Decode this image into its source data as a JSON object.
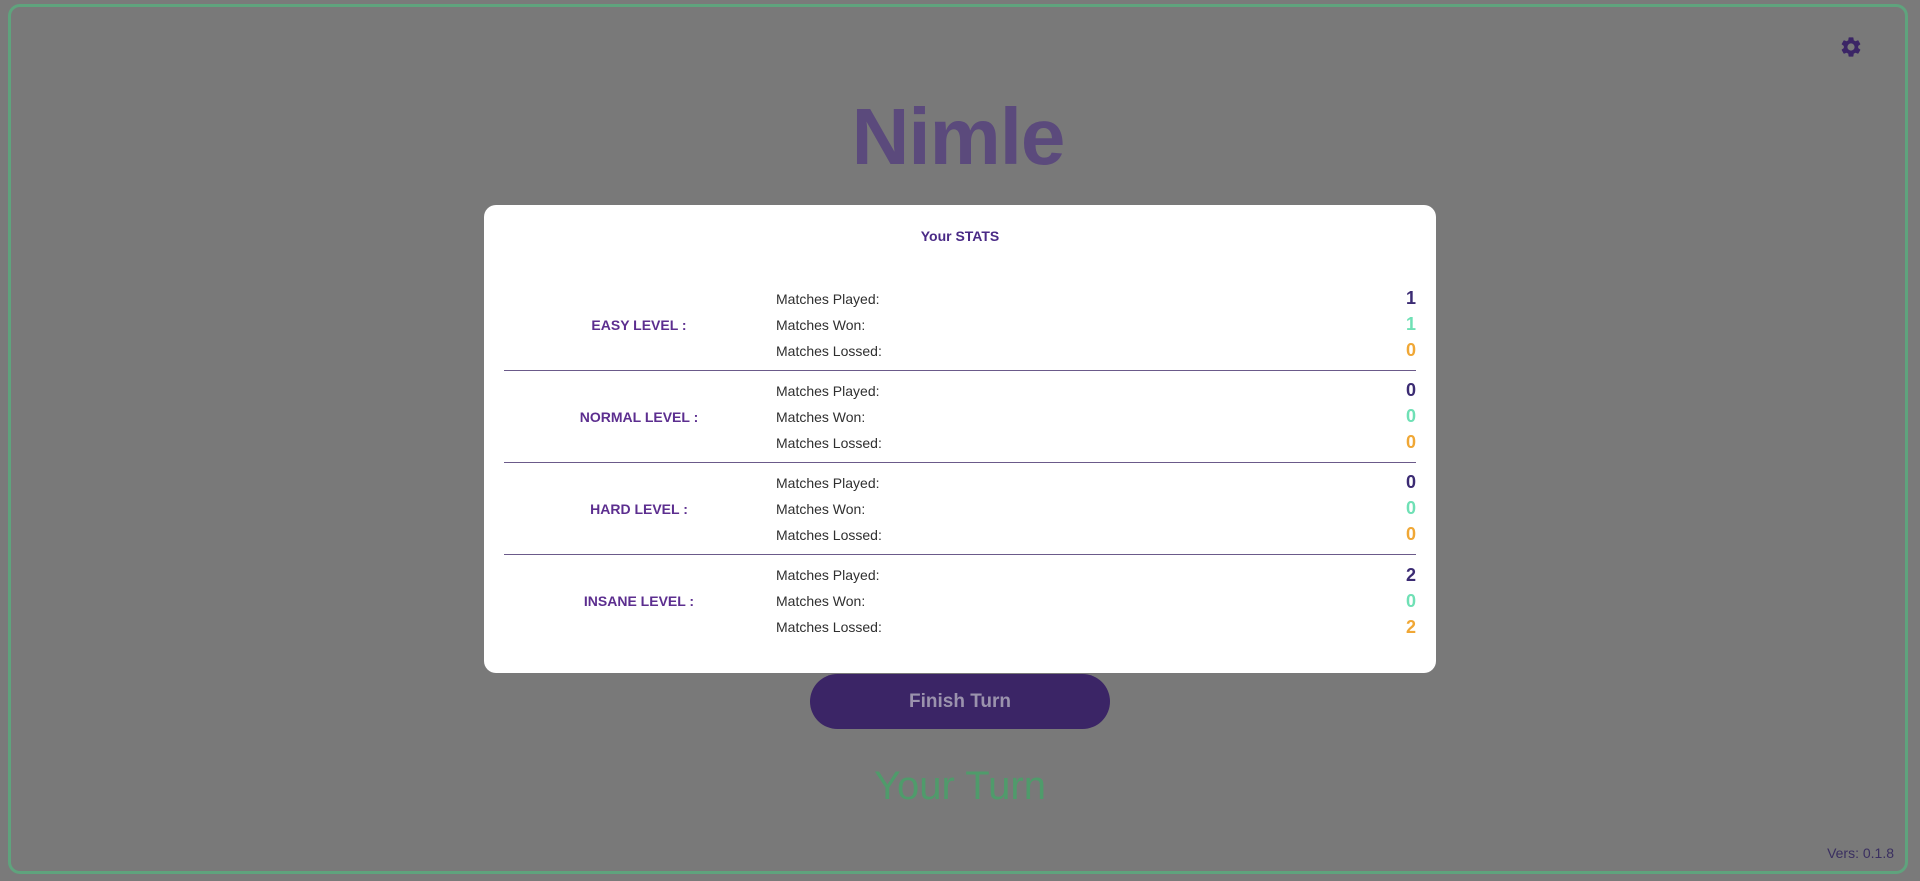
{
  "app": {
    "title": "Nimle",
    "finish_turn_label": "Finish Turn",
    "turn_status": "Your Turn",
    "version": "Vers: 0.1.8"
  },
  "stats": {
    "title": "Your STATS",
    "colors": {
      "played": "#3b2b73",
      "won": "#6fe0b5",
      "lost": "#f0a735"
    },
    "levels": [
      {
        "name": "EASY LEVEL :",
        "rows": [
          {
            "label": "Matches Played:",
            "value": "1",
            "kind": "played"
          },
          {
            "label": "Matches Won:",
            "value": "1",
            "kind": "won"
          },
          {
            "label": "Matches Lossed:",
            "value": "0",
            "kind": "lost"
          }
        ]
      },
      {
        "name": "NORMAL LEVEL :",
        "rows": [
          {
            "label": "Matches Played:",
            "value": "0",
            "kind": "played"
          },
          {
            "label": "Matches Won:",
            "value": "0",
            "kind": "won"
          },
          {
            "label": "Matches Lossed:",
            "value": "0",
            "kind": "lost"
          }
        ]
      },
      {
        "name": "HARD LEVEL :",
        "rows": [
          {
            "label": "Matches Played:",
            "value": "0",
            "kind": "played"
          },
          {
            "label": "Matches Won:",
            "value": "0",
            "kind": "won"
          },
          {
            "label": "Matches Lossed:",
            "value": "0",
            "kind": "lost"
          }
        ]
      },
      {
        "name": "INSANE LEVEL :",
        "rows": [
          {
            "label": "Matches Played:",
            "value": "2",
            "kind": "played"
          },
          {
            "label": "Matches Won:",
            "value": "0",
            "kind": "won"
          },
          {
            "label": "Matches Lossed:",
            "value": "2",
            "kind": "lost"
          }
        ]
      }
    ]
  }
}
